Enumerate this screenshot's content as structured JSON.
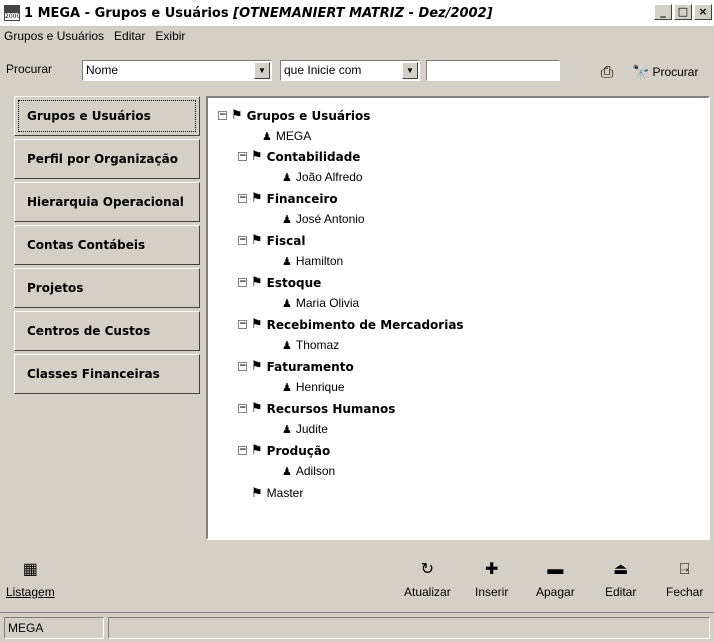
{
  "window": {
    "app_icon_text": "2000",
    "title": "1 MEGA - Grupos e Usuários",
    "subtitle": "[OTNEMANIERT MATRIZ - Dez/2002]",
    "controls": [
      "_",
      "□",
      "×"
    ]
  },
  "menu": [
    "Grupos e Usuários",
    "Editar",
    "Exibir"
  ],
  "toolbar": {
    "search_label": "Procurar",
    "field_value": "Nome",
    "operator_value": "que Inicie com",
    "search_text": "",
    "search_button_label": "Procurar"
  },
  "tabs": [
    "Grupos e Usuários",
    "Perfil por Organização",
    "Hierarquia Operacional",
    "Contas Contábeis",
    "Projetos",
    "Centros de Custos",
    "Classes Financeiras"
  ],
  "tree": {
    "root": "Grupos e Usuários",
    "root_user": "MEGA",
    "groups": [
      {
        "name": "Contabilidade",
        "user": "João Alfredo"
      },
      {
        "name": "Financeiro",
        "user": "José Antonio"
      },
      {
        "name": "Fiscal",
        "user": "Hamilton"
      },
      {
        "name": "Estoque",
        "user": "Maria Olivia"
      },
      {
        "name": "Recebimento de Mercadorias",
        "user": "Thomaz"
      },
      {
        "name": "Faturamento",
        "user": "Henrique"
      },
      {
        "name": "Recursos Humanos",
        "user": "Judite"
      },
      {
        "name": "Produção",
        "user": "Adilson"
      }
    ],
    "master": "Master"
  },
  "bottom": {
    "listagem": "Listagem",
    "atualizar": "Atualizar",
    "inserir": "Inserir",
    "apagar": "Apagar",
    "editar": "Editar",
    "fechar": "Fechar"
  },
  "status": {
    "user": "MEGA"
  }
}
